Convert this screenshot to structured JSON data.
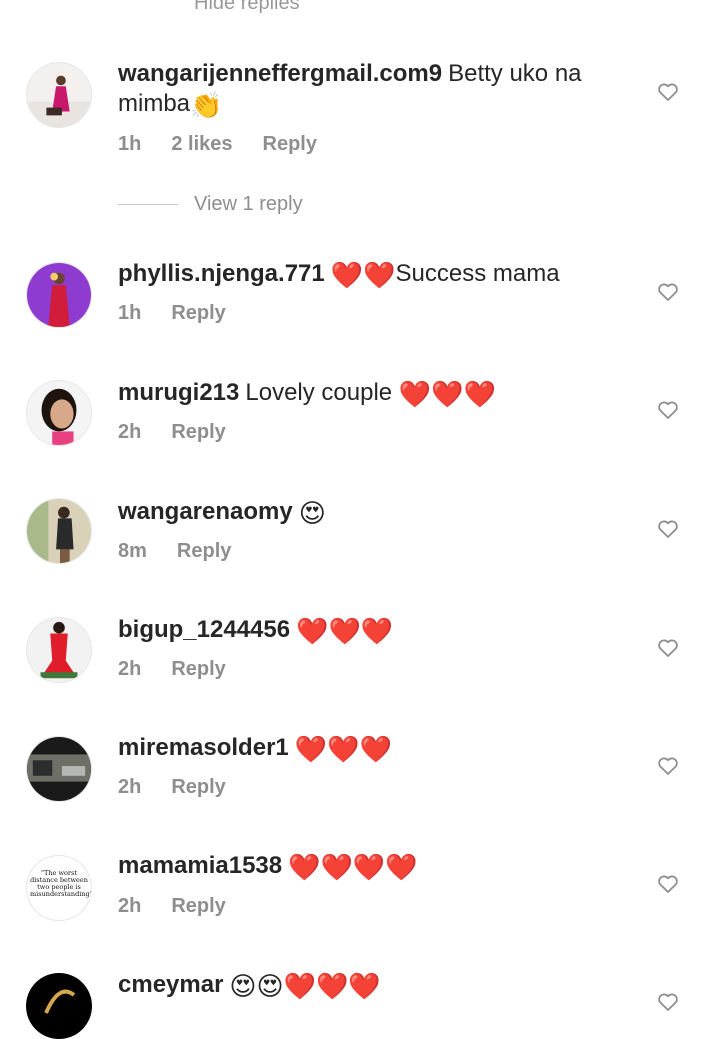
{
  "header": {
    "hide_replies": "Hide replies"
  },
  "view_replies": "View 1 reply",
  "comments": [
    {
      "user": "wangarijenneffergmail.com9",
      "text": "Betty uko na",
      "text2": "mimba",
      "emoji": "👏",
      "time": "1h",
      "likes": "2 likes",
      "reply": "Reply"
    },
    {
      "user": "phyllis.njenga.771",
      "emoji": "❤️❤️",
      "text": "Success  mama",
      "time": "1h",
      "reply": "Reply"
    },
    {
      "user": "murugi213",
      "text": "Lovely couple",
      "emoji": "❤️❤️❤️",
      "time": "2h",
      "reply": "Reply"
    },
    {
      "user": "wangarenaomy",
      "emoji": "😍",
      "time": "8m",
      "reply": "Reply"
    },
    {
      "user": "bigup_1244456",
      "emoji": "❤️❤️❤️",
      "time": "2h",
      "reply": "Reply"
    },
    {
      "user": "miremasolder1",
      "emoji": "❤️❤️❤️",
      "time": "2h",
      "reply": "Reply"
    },
    {
      "user": "mamamia1538",
      "emoji": "❤️❤️❤️❤️",
      "time": "2h",
      "reply": "Reply",
      "avatar_text": "\"The worst distance between two people is misunderstanding\""
    },
    {
      "user": "cmeymar",
      "emoji": "😍😍❤️❤️❤️"
    }
  ],
  "icons": {
    "like": "heart-outline-icon"
  },
  "colors": {
    "meta": "#8e8e8e",
    "heart": "#e0101c",
    "text": "#262626"
  }
}
